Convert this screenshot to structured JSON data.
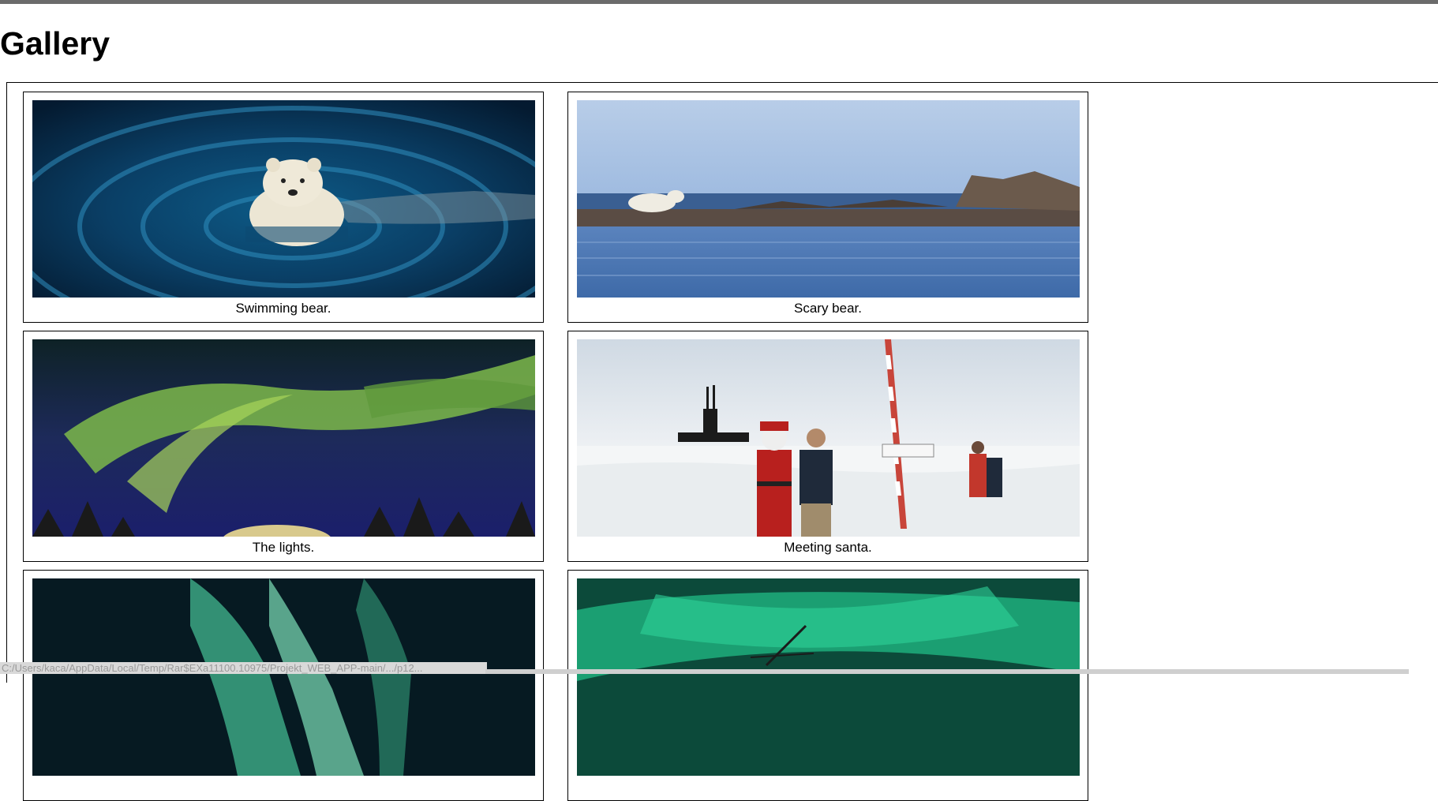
{
  "page": {
    "title": "Gallery"
  },
  "gallery": {
    "items": [
      {
        "caption": "Swimming bear.",
        "image": "polar-bear-swimming"
      },
      {
        "caption": "Scary bear.",
        "image": "polar-bear-on-shore"
      },
      {
        "caption": "The lights.",
        "image": "aurora-green-sky"
      },
      {
        "caption": "Meeting santa.",
        "image": "santa-at-north-pole"
      },
      {
        "caption": "",
        "image": "aurora-curtain"
      },
      {
        "caption": "",
        "image": "aurora-overhead"
      }
    ]
  },
  "status_bar": {
    "url": "C:/Users/kaca/AppData/Local/Temp/Rar$EXa11100.10975/Projekt_WEB_APP-main/.../p12..."
  }
}
